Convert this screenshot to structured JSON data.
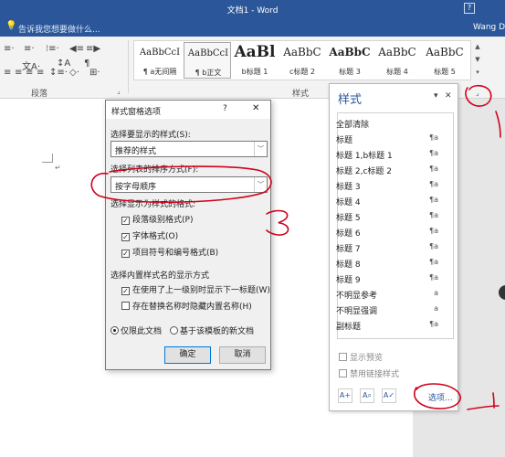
{
  "window": {
    "title": "文档1 - Word",
    "help_glyph": "?"
  },
  "tellbar": {
    "bulb_glyph": "💡",
    "placeholder": "告诉我您想要做什么...",
    "user": "Wang D"
  },
  "ribbon": {
    "icons_row1": [
      "≡·",
      "≡·",
      "⁝≡·",
      "◀≡",
      "≡▶",
      "文A·",
      "↕A",
      "¶"
    ],
    "icons_row2": [
      "≡",
      "≡",
      "≡",
      "≡",
      "↕≡·",
      "◇·",
      "⊞·"
    ],
    "paragraph_group_label": "段落",
    "styles_group_label": "样式",
    "launcher_glyph": "⌟",
    "gallery": [
      {
        "sample": "AaBbCcI",
        "name": "¶ a无间隔",
        "sample_size": 10,
        "bold": false,
        "active": false
      },
      {
        "sample": "AaBbCcI",
        "name": "¶ b正文",
        "sample_size": 10,
        "bold": false,
        "active": true
      },
      {
        "sample": "AaBl",
        "name": "b标题 1",
        "sample_size": 17,
        "bold": true,
        "active": false
      },
      {
        "sample": "AaBbC",
        "name": "c标题 2",
        "sample_size": 13,
        "bold": false,
        "active": false
      },
      {
        "sample": "AaBbC",
        "name": "标题 3",
        "sample_size": 13,
        "bold": true,
        "active": false
      },
      {
        "sample": "AaBbC",
        "name": "标题 4",
        "sample_size": 13,
        "bold": false,
        "active": false
      },
      {
        "sample": "AaBbC",
        "name": "标题 5",
        "sample_size": 13,
        "bold": false,
        "active": false
      }
    ],
    "gallery_scroll": [
      "▲",
      "▼",
      "▾"
    ]
  },
  "document": {
    "para_mark": "↵"
  },
  "dialog": {
    "title": "样式窗格选项",
    "help": "?",
    "close": "✕",
    "show_label": "选择要显示的样式(S):",
    "show_value": "推荐的样式",
    "sort_label": "选择列表的排序方式(F):",
    "sort_value": "按字母顺序",
    "format_label": "选择显示为样式的格式:",
    "format_checks": [
      {
        "label": "段落级别格式(P)",
        "checked": true
      },
      {
        "label": "字体格式(O)",
        "checked": true
      },
      {
        "label": "项目符号和编号格式(B)",
        "checked": true
      }
    ],
    "builtin_label": "选择内置样式名的显示方式",
    "builtin_checks": [
      {
        "label": "在使用了上一级别时显示下一标题(W)",
        "checked": true
      },
      {
        "label": "存在替换名称时隐藏内置名称(H)",
        "checked": false
      }
    ],
    "radio_doc": "仅限此文档",
    "radio_template": "基于该模板的新文档",
    "ok": "确定",
    "cancel": "取消",
    "dropdown_glyph": "﹀",
    "check_glyph": "✓"
  },
  "pane": {
    "title": "样式",
    "pin_glyph": "▾",
    "close_glyph": "✕",
    "items": [
      {
        "name": "全部清除",
        "mark": ""
      },
      {
        "name": "标题",
        "mark": "¶a"
      },
      {
        "name": "标题 1,b标题 1",
        "mark": "¶a"
      },
      {
        "name": "标题 2,c标题 2",
        "mark": "¶a"
      },
      {
        "name": "标题 3",
        "mark": "¶a"
      },
      {
        "name": "标题 4",
        "mark": "¶a"
      },
      {
        "name": "标题 5",
        "mark": "¶a"
      },
      {
        "name": "标题 6",
        "mark": "¶a"
      },
      {
        "name": "标题 7",
        "mark": "¶a"
      },
      {
        "name": "标题 8",
        "mark": "¶a"
      },
      {
        "name": "标题 9",
        "mark": "¶a"
      },
      {
        "name": "不明显参考",
        "mark": "a"
      },
      {
        "name": "不明显强调",
        "mark": "a"
      },
      {
        "name": "副标题",
        "mark": "¶a"
      }
    ],
    "show_preview": "显示预览",
    "disable_linked": "禁用链接样式",
    "btn_new": "A+",
    "btn_inspect": "A⌕",
    "btn_manage": "A✓",
    "options_link": "选项..."
  },
  "colors": {
    "accent": "#2b579a",
    "annotation": "#d0021b"
  }
}
